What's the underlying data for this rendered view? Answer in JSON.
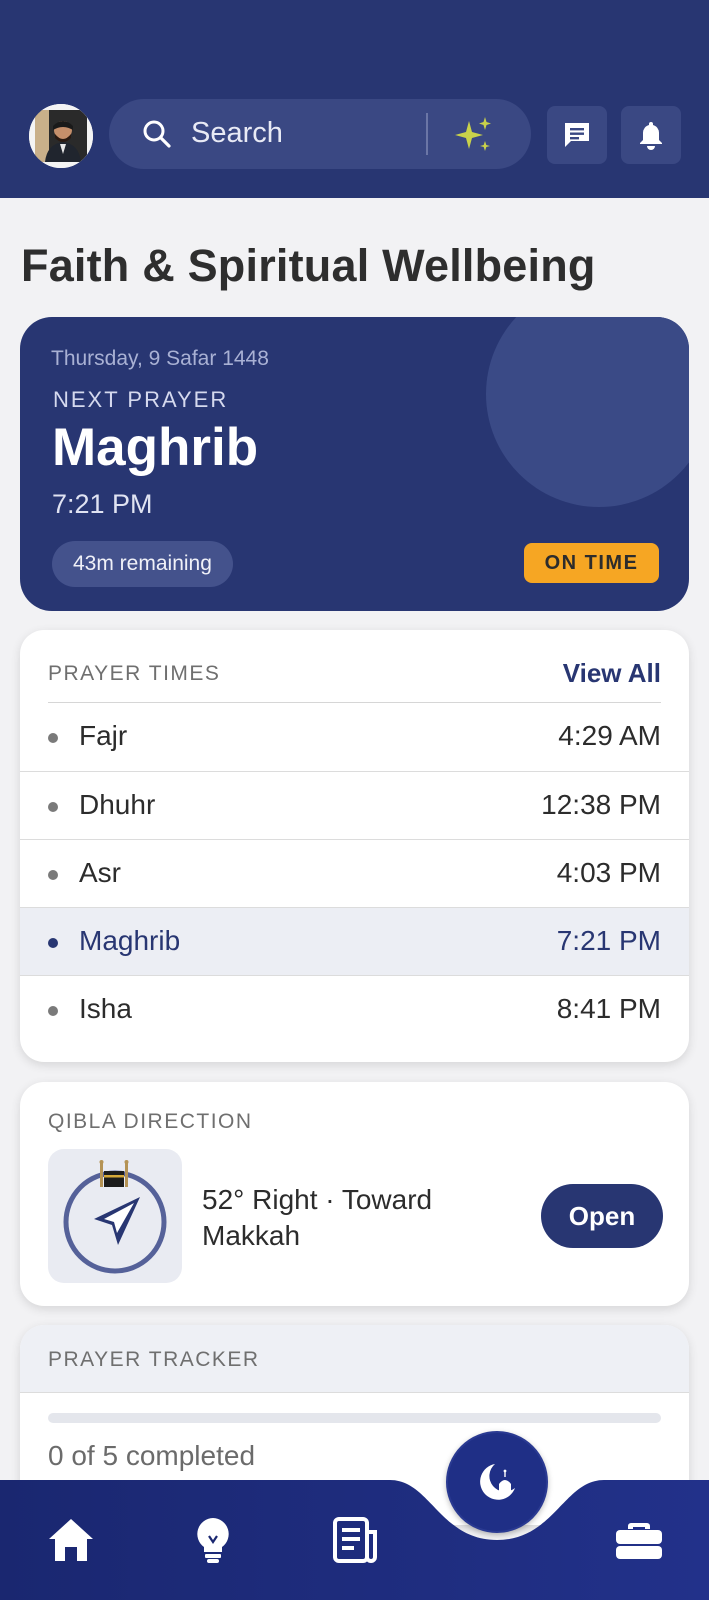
{
  "header": {
    "search_placeholder": "Search",
    "colors": {
      "background": "#283672",
      "sparkle": "#c9d24a"
    },
    "icons": [
      "avatar",
      "search-icon",
      "sparkle-icon",
      "message-icon",
      "bell-icon"
    ]
  },
  "page": {
    "title": "Faith & Spiritual Wellbeing"
  },
  "next_prayer": {
    "hijri_date": "Thursday, 9 Safar 1448",
    "label": "NEXT PRAYER",
    "name": "Maghrib",
    "time": "7:21 PM",
    "remaining": "43m remaining",
    "status": "ON TIME",
    "status_color": "#f6a623"
  },
  "prayer_times": {
    "label": "PRAYER TIMES",
    "view_all": "View All",
    "rows": [
      {
        "name": "Fajr",
        "time": "4:29 AM",
        "active": false
      },
      {
        "name": "Dhuhr",
        "time": "12:38 PM",
        "active": false
      },
      {
        "name": "Asr",
        "time": "4:03 PM",
        "active": false
      },
      {
        "name": "Maghrib",
        "time": "7:21 PM",
        "active": true
      },
      {
        "name": "Isha",
        "time": "8:41 PM",
        "active": false
      }
    ]
  },
  "qibla": {
    "label": "QIBLA DIRECTION",
    "direction_text": "52° Right · Toward Makkah",
    "open_label": "Open"
  },
  "tracker": {
    "label": "PRAYER TRACKER",
    "completed_text": "0 of 5 completed",
    "progress_fraction": 0
  },
  "bottom_nav": {
    "items": [
      "home-icon",
      "lightbulb-icon",
      "news-icon",
      "crescent-mosque-icon",
      "briefcase-icon"
    ],
    "active": "crescent-mosque-icon",
    "background": "#1f2d80"
  }
}
